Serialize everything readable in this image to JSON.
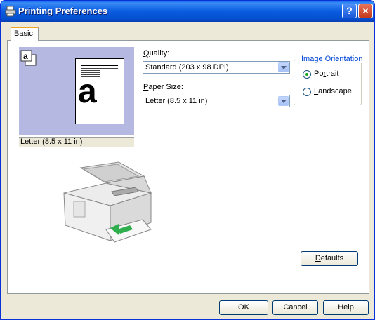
{
  "window": {
    "title": "Printing Preferences",
    "help_label": "?",
    "close_label": "×"
  },
  "tabs": [
    {
      "label": "Basic"
    }
  ],
  "preview": {
    "size_label": "Letter (8.5 x 11 in)",
    "page_letter": "a",
    "icon_letter": "a"
  },
  "quality": {
    "label_prefix": "",
    "label_underlined": "Q",
    "label_rest": "uality:",
    "value": "Standard (203 x 98 DPI)"
  },
  "paper_size": {
    "label_underlined": "P",
    "label_rest": "aper Size:",
    "value": "Letter (8.5 x 11 in)"
  },
  "orientation": {
    "title": "Image Orientation",
    "portrait": {
      "pre": "Po",
      "underlined": "r",
      "post": "trait",
      "selected": true
    },
    "landscape": {
      "pre": "",
      "underlined": "L",
      "post": "andscape",
      "selected": false
    }
  },
  "buttons": {
    "defaults": {
      "underlined": "D",
      "rest": "efaults"
    },
    "ok": "OK",
    "cancel": "Cancel",
    "help": "Help"
  }
}
